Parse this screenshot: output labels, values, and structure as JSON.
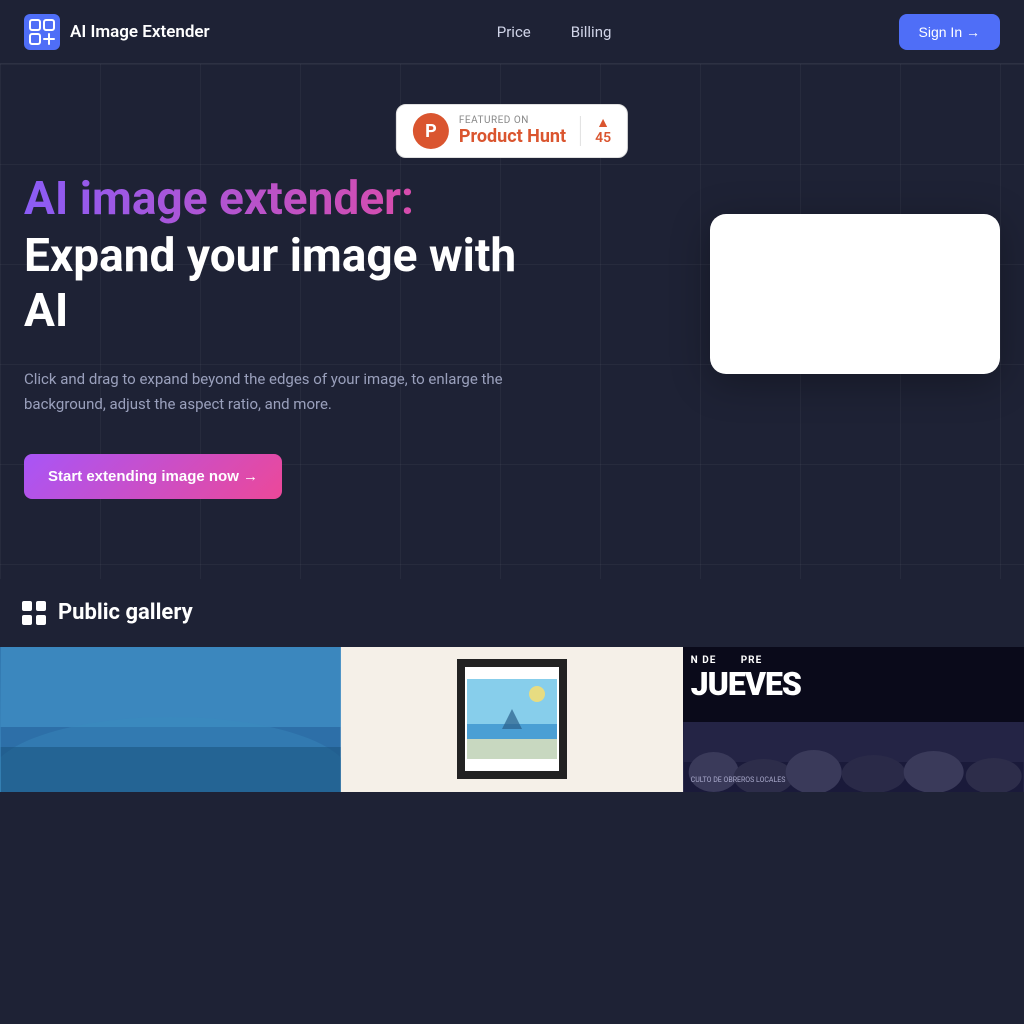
{
  "navbar": {
    "logo_text": "AI Image Extender",
    "links": [
      {
        "label": "Price",
        "id": "price"
      },
      {
        "label": "Billing",
        "id": "billing"
      }
    ],
    "signin_label": "Sign In →"
  },
  "product_hunt": {
    "featured_label": "FEATURED ON",
    "name": "Product Hunt",
    "vote_count": "45"
  },
  "hero": {
    "heading_gradient": "AI image extender:",
    "heading_white_line1": "Expand your image with",
    "heading_white_line2": "AI",
    "description": "Click and drag to expand beyond the edges of your image, to enlarge the background, adjust the aspect ratio, and more.",
    "cta_label": "Start extending image now →"
  },
  "gallery": {
    "section_title": "Public gallery"
  },
  "icons": {
    "logo": "image-extend-icon",
    "gallery": "grid-icon",
    "arrow_up": "▲"
  }
}
